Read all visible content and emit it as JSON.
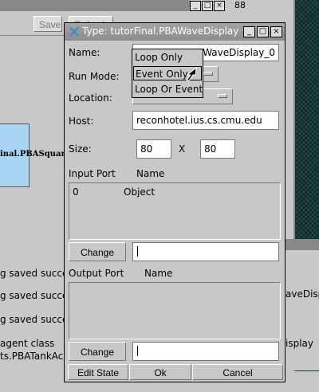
{
  "background": {
    "top_buttons": [
      {
        "label": "Save"
      },
      {
        "label": "Refresh"
      }
    ],
    "top_number": "88",
    "node_label": "inal.PBASquareW",
    "log_lines": [
      "g saved succe",
      "g saved succe",
      "g saved succe",
      "agent class",
      "ts.PBATankAc"
    ],
    "right_text": [
      "aveDispla",
      "isplay"
    ]
  },
  "dialog": {
    "title": "Type: tutorFinal.PBAWaveDisplay",
    "labels": {
      "name": "Name:",
      "run_mode": "Run Mode:",
      "location": "Location:",
      "host": "Host:",
      "size": "Size:",
      "size_x": "X"
    },
    "name_value": "WaveDisplay_0",
    "host_value": "reconhotel.ius.cs.cmu.edu",
    "size_width": "80",
    "size_height": "80",
    "input_header": {
      "port": "Input Port",
      "name": "Name"
    },
    "input_rows": [
      {
        "port": "0",
        "name": "Object"
      }
    ],
    "output_header": {
      "port": "Output Port",
      "name": "Name"
    },
    "output_rows": [],
    "change_label": "Change",
    "buttons": {
      "edit_state": "Edit State",
      "ok": "Ok",
      "cancel": "Cancel"
    }
  },
  "run_mode_menu": {
    "items": [
      "Loop Only",
      "Event Only",
      "Loop Or Event"
    ],
    "highlighted": "Event Only"
  },
  "colors": {
    "accent": "#2a8cd8",
    "node_fill": "#aad4f4"
  },
  "icons": {
    "title": "x-logo-icon",
    "window_controls": [
      "minimize-icon",
      "maximize-icon",
      "close-icon"
    ]
  }
}
